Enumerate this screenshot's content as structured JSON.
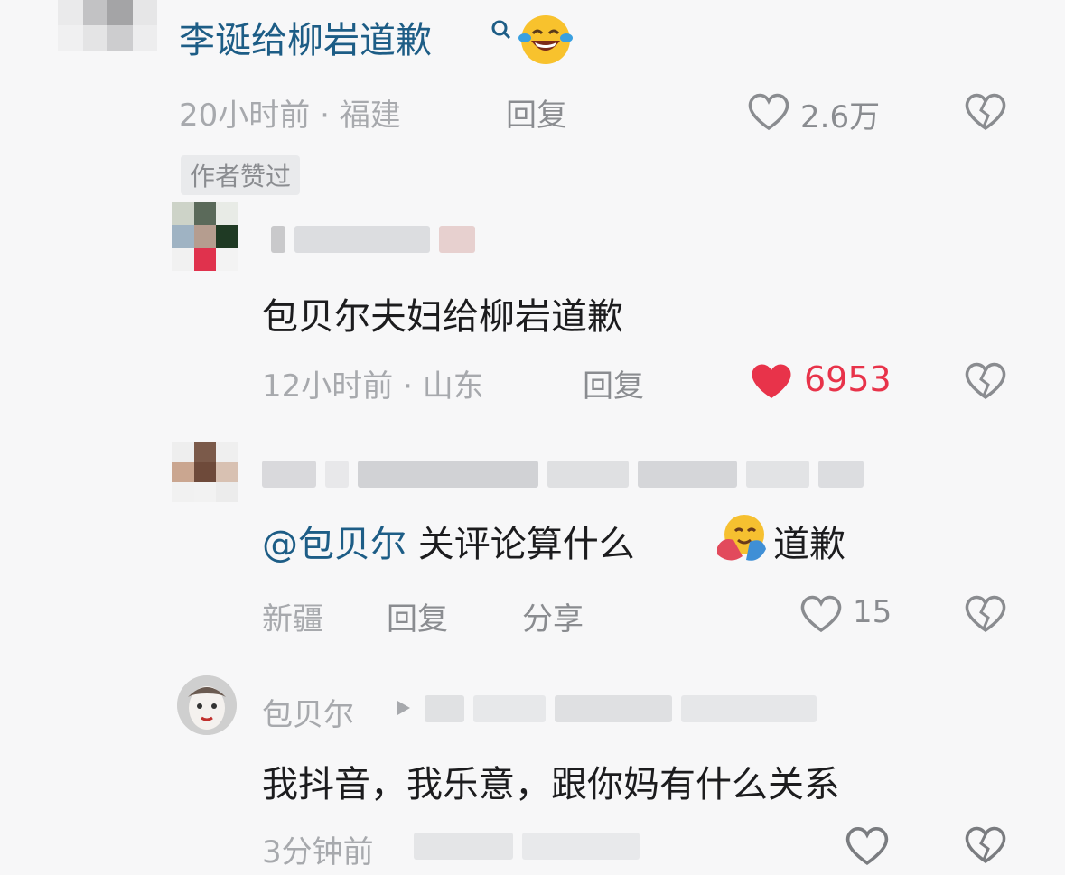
{
  "comments": [
    {
      "text": "李诞给柳岩道歉",
      "search_icon": "search-icon",
      "emoji": "laughing-tears-emoji",
      "time": "20小时前",
      "location": "福建",
      "reply_label": "回复",
      "likes": "2.6万",
      "liked": false,
      "badge": "作者赞过"
    },
    {
      "text": "包贝尔夫妇给柳岩道歉",
      "time": "12小时前",
      "location": "山东",
      "reply_label": "回复",
      "likes": "6953",
      "liked": true
    },
    {
      "mention": "@包贝尔",
      "text_before_emoji": "关评论算什么",
      "emoji": "hugging-face-emoji",
      "text_after_emoji": "道歉",
      "location": "新疆",
      "reply_label": "回复",
      "share_label": "分享",
      "likes": "15",
      "liked": false
    },
    {
      "username": "包贝尔",
      "text": "我抖音，我乐意，跟你妈有什么关系",
      "time": "3分钟前"
    }
  ],
  "colors": {
    "link": "#1d5d86",
    "like_active": "#e8334a",
    "meta": "#a7a9ad"
  }
}
